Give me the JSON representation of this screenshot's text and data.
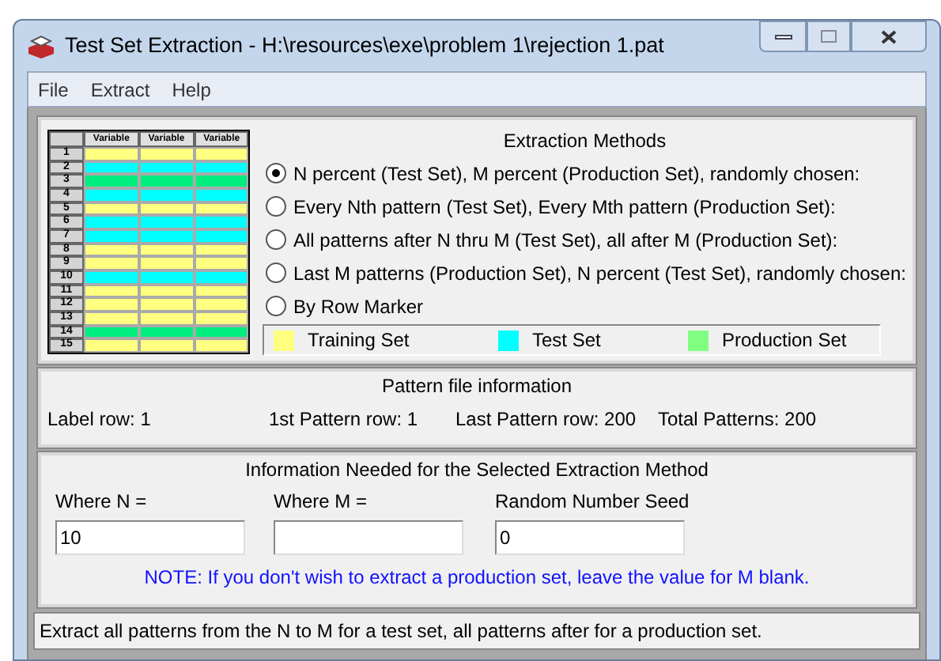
{
  "window": {
    "title": "Test Set Extraction - H:\\resources\\exe\\problem 1\\rejection 1.pat"
  },
  "menu": [
    "File",
    "Extract",
    "Help"
  ],
  "sample_grid": {
    "columns": [
      "Variable",
      "Variable",
      "Variable"
    ],
    "rows": [
      {
        "number": "1",
        "color": "#ffff80"
      },
      {
        "number": "2",
        "color": "#00ffff"
      },
      {
        "number": "3",
        "color": "#00ee80"
      },
      {
        "number": "4",
        "color": "#00ffff"
      },
      {
        "number": "5",
        "color": "#ffff80"
      },
      {
        "number": "6",
        "color": "#00ffff"
      },
      {
        "number": "7",
        "color": "#00ffff"
      },
      {
        "number": "8",
        "color": "#ffff80"
      },
      {
        "number": "9",
        "color": "#ffff80"
      },
      {
        "number": "10",
        "color": "#00ffff"
      },
      {
        "number": "11",
        "color": "#ffff80"
      },
      {
        "number": "12",
        "color": "#ffff80"
      },
      {
        "number": "13",
        "color": "#ffff80"
      },
      {
        "number": "14",
        "color": "#00ee80"
      },
      {
        "number": "15",
        "color": "#ffff80"
      }
    ]
  },
  "extraction_methods": {
    "title": "Extraction Methods",
    "options": [
      {
        "label": "N percent (Test Set), M percent (Production Set), randomly chosen:",
        "selected": true
      },
      {
        "label": "Every Nth pattern (Test Set), Every Mth pattern (Production Set):",
        "selected": false
      },
      {
        "label": "All patterns after N thru M (Test Set), all after M (Production Set):",
        "selected": false
      },
      {
        "label": "Last M patterns (Production Set), N percent (Test Set), randomly chosen:",
        "selected": false
      },
      {
        "label": "By Row Marker",
        "selected": false
      }
    ]
  },
  "legend": [
    {
      "label": "Training Set",
      "color": "#ffff80"
    },
    {
      "label": "Test Set",
      "color": "#00ffff"
    },
    {
      "label": "Production Set",
      "color": "#80ff80"
    }
  ],
  "pattern_info": {
    "title": "Pattern file information",
    "items": [
      "Label row: 1",
      "1st Pattern row: 1",
      "Last Pattern row: 200",
      "Total Patterns: 200"
    ]
  },
  "method_info": {
    "title": "Information Needed for the Selected Extraction Method",
    "fields": [
      {
        "label": "Where N =",
        "value": "10"
      },
      {
        "label": "Where M ="
      },
      {
        "label": "Random Number Seed",
        "value": "0"
      }
    ],
    "note": "NOTE: If you don't wish to extract a production set, leave the value for M blank."
  },
  "status_bar": "Extract all patterns from the N to M for a test set, all patterns after for a production set."
}
